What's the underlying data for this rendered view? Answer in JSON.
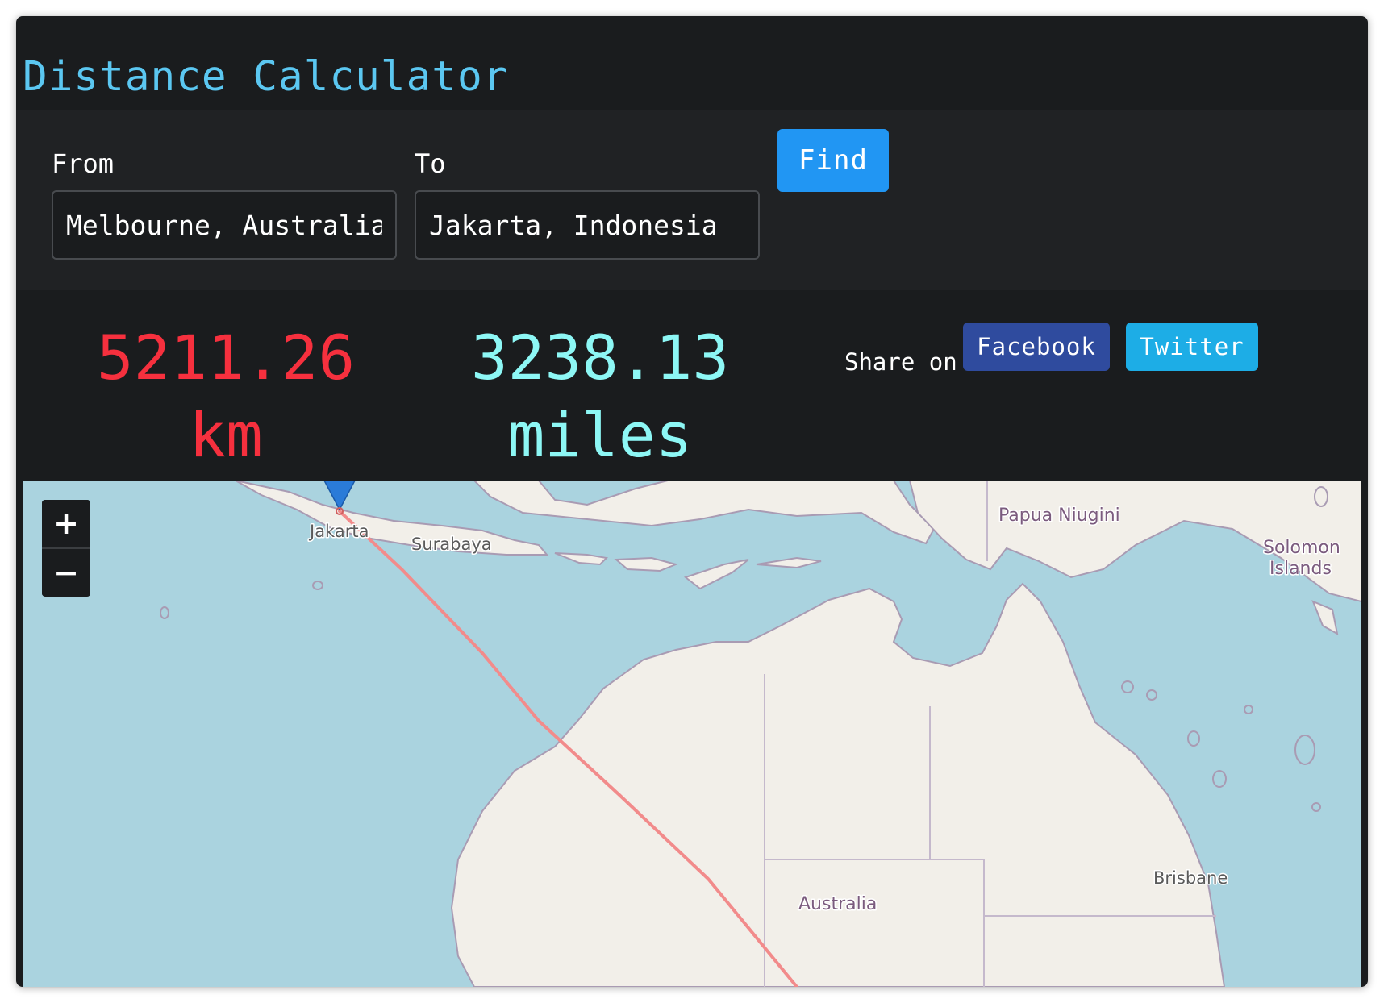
{
  "header": {
    "title": "Distance Calculator"
  },
  "form": {
    "from_label": "From",
    "from_value": "Melbourne, Australia",
    "to_label": "To",
    "to_value": "Jakarta, Indonesia",
    "find_label": "Find"
  },
  "result": {
    "km_value": "5211.26",
    "km_unit": "km",
    "miles_value": "3238.13",
    "miles_unit": "miles"
  },
  "share": {
    "label": "Share on",
    "facebook": "Facebook",
    "twitter": "Twitter"
  },
  "map": {
    "zoom_in": "+",
    "zoom_out": "−",
    "labels": {
      "jakarta": "Jakarta",
      "surabaya": "Surabaya",
      "papua": "Papua Niugini",
      "solomon_1": "Solomon",
      "solomon_2": "Islands",
      "australia": "Australia",
      "brisbane": "Brisbane"
    },
    "icons": {
      "marker": "map-marker-icon",
      "zoom_in": "plus-icon",
      "zoom_out": "minus-icon"
    },
    "colors": {
      "water": "#aad3df",
      "land": "#f2efe9",
      "route": "#f28b8b",
      "marker": "#2a7bd8"
    }
  }
}
